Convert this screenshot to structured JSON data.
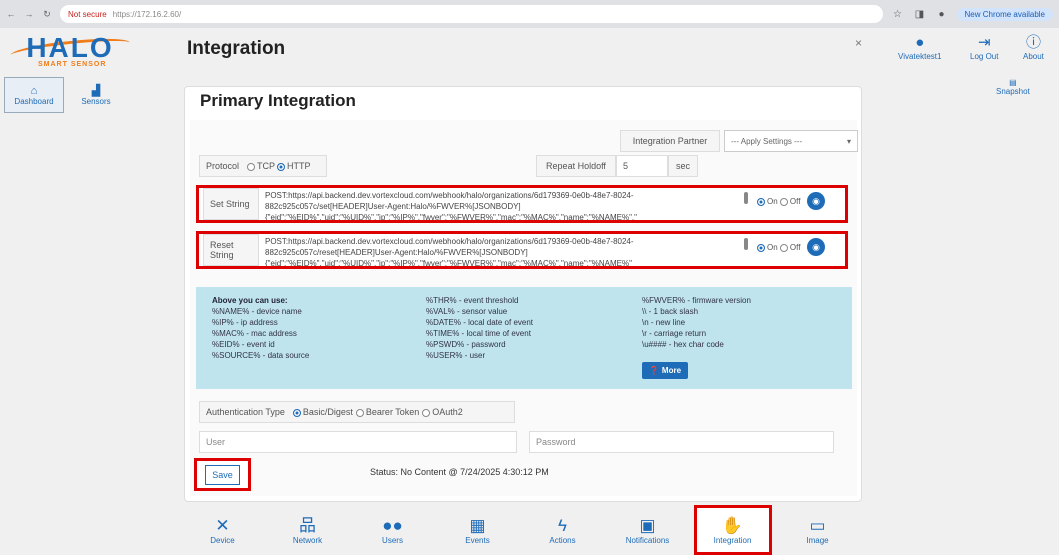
{
  "browser": {
    "not_secure": "Not secure",
    "address": "https://172.16.2.60/",
    "new_chrome": "New Chrome available"
  },
  "logo": {
    "halo": "HALO",
    "sub": "SMART SENSOR"
  },
  "header": {
    "title": "Integration",
    "user": "Vivatektest1",
    "logout": "Log Out",
    "about": "About"
  },
  "leftnav": [
    {
      "label": "Dashboard"
    },
    {
      "label": "Sensors"
    }
  ],
  "snapshot": "Snapshot",
  "panel": {
    "title": "Primary Integration",
    "partner_label": "Integration Partner",
    "partner_value": "--- Apply Settings ---",
    "protocol_label": "Protocol",
    "protocol_tcp": "TCP",
    "protocol_http": "HTTP",
    "repeat_label": "Repeat Holdoff",
    "repeat_value": "5",
    "repeat_unit": "sec",
    "set_label": "Set String",
    "set_line1": "POST:https://api.backend.dev.vortexcloud.com/webhook/halo/organizations/6d179369-0e0b-48e7-8024-",
    "set_line2": "882c925c057c/set[HEADER]User-Agent:Halo/%FWVER%[JSONBODY]",
    "set_line3": "{\"eid\":\"%EID%\",\"uid\":\"%UID%\",\"ip\":\"%IP%\",\"fwver\":\"%FWVER%\",\"mac\":\"%MAC%\",\"name\":\"%NAME%\",\"",
    "reset_label": "Reset String",
    "reset_line1": "POST:https://api.backend.dev.vortexcloud.com/webhook/halo/organizations/6d179369-0e0b-48e7-8024-",
    "reset_line2": "882c925c057c/reset[HEADER]User-Agent:Halo/%FWVER%[JSONBODY]",
    "reset_line3": "{\"eid\":\"%EID%\",\"uid\":\"%UID%\",\"ip\":\"%IP%\",\"fwver\":\"%FWVER%\",\"mac\":\"%MAC%\",\"name\":\"%NAME%\"",
    "on": "On",
    "off": "Off",
    "help": {
      "heading": "Above you can use:",
      "col1": [
        "%NAME% - device name",
        "%IP% - ip address",
        "%MAC% - mac address",
        "%EID% - event id",
        "%SOURCE% - data source"
      ],
      "col2": [
        "%THR% - event threshold",
        "%VAL% - sensor value",
        "%DATE% - local date of event",
        "%TIME% - local time of event",
        "%PSWD% - password",
        "%USER% - user"
      ],
      "col3": [
        "%FWVER% - firmware version",
        "\\\\ - 1 back slash",
        "\\n - new line",
        "\\r - carriage return",
        "\\u#### - hex char code"
      ],
      "more": "More"
    },
    "auth_label": "Authentication Type",
    "auth_basic": "Basic/Digest",
    "auth_bearer": "Bearer Token",
    "auth_oauth": "OAuth2",
    "user_label": "User",
    "password_label": "Password",
    "save": "Save",
    "status": "Status: No Content @ 7/24/2025 4:30:12 PM"
  },
  "bottomnav": [
    {
      "label": "Device"
    },
    {
      "label": "Network"
    },
    {
      "label": "Users"
    },
    {
      "label": "Events"
    },
    {
      "label": "Actions"
    },
    {
      "label": "Notifications"
    },
    {
      "label": "Integration"
    },
    {
      "label": "Image"
    }
  ]
}
